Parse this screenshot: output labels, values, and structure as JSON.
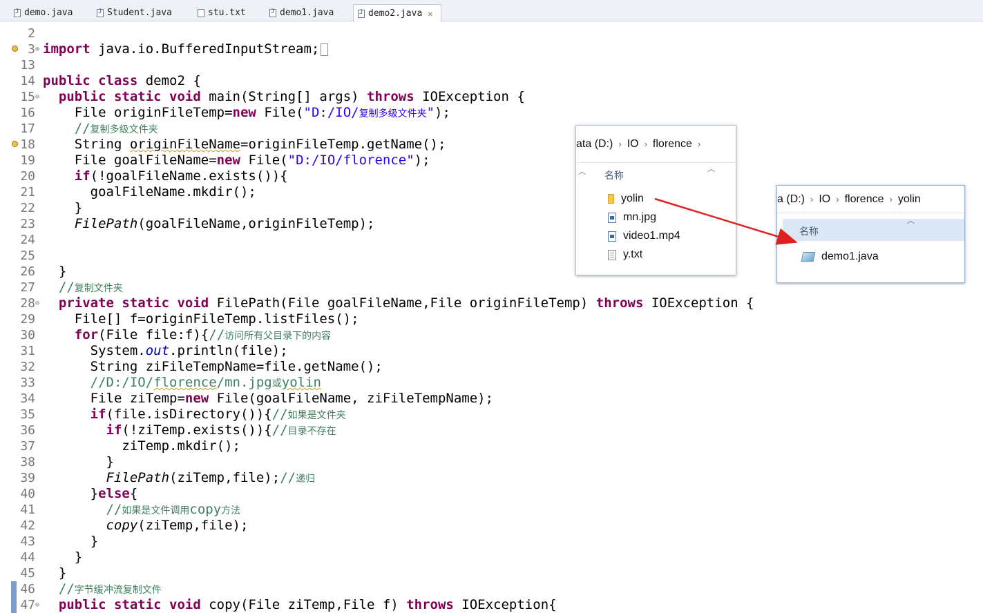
{
  "tabs": [
    {
      "label": "demo.java",
      "icon": "java-file-icon"
    },
    {
      "label": "Student.java",
      "icon": "java-file-icon"
    },
    {
      "label": "stu.txt",
      "icon": "text-file-icon"
    },
    {
      "label": "demo1.java",
      "icon": "java-file-icon"
    },
    {
      "label": "demo2.java",
      "icon": "java-file-icon",
      "active": true,
      "close": "✕"
    }
  ],
  "code_lines": [
    {
      "n": "2",
      "t": []
    },
    {
      "n": "3",
      "fold": "⊕",
      "marker": true,
      "t": [
        [
          "kw",
          "import"
        ],
        [
          "",
          "  java.io.BufferedInputStream;"
        ]
      ],
      "box": true
    },
    {
      "n": "13",
      "t": []
    },
    {
      "n": "14",
      "t": [
        [
          "kw",
          "public class"
        ],
        [
          "",
          "  demo2 {"
        ]
      ]
    },
    {
      "n": "15",
      "fold": "⊖",
      "t": [
        [
          "",
          "    "
        ],
        [
          "kw",
          "public static void"
        ],
        [
          "",
          "  main(String[] args) "
        ],
        [
          "kw",
          "throws"
        ],
        [
          "",
          "  IOException {"
        ]
      ]
    },
    {
      "n": "16",
      "t": [
        [
          "",
          "        File originFileTemp="
        ],
        [
          "kw",
          "new"
        ],
        [
          "",
          "  File("
        ],
        [
          "str",
          "\"D:/IO/"
        ],
        [
          "str cn",
          "复制多级文件夹"
        ],
        [
          "str",
          "\""
        ],
        [
          "",
          ");"
        ]
      ]
    },
    {
      "n": "17",
      "t": [
        [
          "",
          "        "
        ],
        [
          "cm",
          "//"
        ],
        [
          "cm cn",
          "复制多级文件夹"
        ]
      ]
    },
    {
      "n": "18",
      "marker": true,
      "t": [
        [
          "",
          "        String "
        ],
        [
          "sq",
          "originFileName"
        ],
        [
          "",
          "=originFileTemp.getName();"
        ]
      ]
    },
    {
      "n": "19",
      "t": [
        [
          "",
          "        File goalFileName="
        ],
        [
          "kw",
          "new"
        ],
        [
          "",
          "  File("
        ],
        [
          "str",
          "\"D:/IO/florence\""
        ],
        [
          "",
          ");"
        ]
      ]
    },
    {
      "n": "20",
      "t": [
        [
          "",
          "        "
        ],
        [
          "kw",
          "if"
        ],
        [
          "",
          "(!goalFileName.exists()){"
        ]
      ]
    },
    {
      "n": "21",
      "t": [
        [
          "",
          "            goalFileName.mkdir();"
        ]
      ]
    },
    {
      "n": "22",
      "t": [
        [
          "",
          "        }"
        ]
      ]
    },
    {
      "n": "23",
      "t": [
        [
          "",
          "        "
        ],
        [
          "it",
          "FilePath"
        ],
        [
          "",
          "(goalFileName,originFileTemp);"
        ]
      ]
    },
    {
      "n": "24",
      "t": []
    },
    {
      "n": "25",
      "t": []
    },
    {
      "n": "26",
      "t": [
        [
          "",
          "    }"
        ]
      ]
    },
    {
      "n": "27",
      "t": [
        [
          "",
          "    "
        ],
        [
          "cm",
          "//"
        ],
        [
          "cm cn",
          "复制文件夹"
        ]
      ]
    },
    {
      "n": "28",
      "fold": "⊖",
      "t": [
        [
          "",
          "    "
        ],
        [
          "kw",
          "private static void"
        ],
        [
          "",
          "  FilePath(File goalFileName,File originFileTemp) "
        ],
        [
          "kw",
          "throws"
        ],
        [
          "",
          "  IOException {"
        ]
      ]
    },
    {
      "n": "29",
      "t": [
        [
          "",
          "        File[] f=originFileTemp.listFiles();"
        ]
      ]
    },
    {
      "n": "30",
      "t": [
        [
          "",
          "        "
        ],
        [
          "kw",
          "for"
        ],
        [
          "",
          "(File file:f){"
        ],
        [
          "cm",
          "//"
        ],
        [
          "cm cn",
          "访问所有父目录下的内容"
        ]
      ]
    },
    {
      "n": "31",
      "t": [
        [
          "",
          "            System."
        ],
        [
          "fld",
          "out"
        ],
        [
          "",
          ".println(file);"
        ]
      ]
    },
    {
      "n": "32",
      "t": [
        [
          "",
          "            String ziFileTempName=file.getName();"
        ]
      ]
    },
    {
      "n": "33",
      "t": [
        [
          "",
          "            "
        ],
        [
          "cm",
          "//D:/IO/"
        ],
        [
          "cm sq",
          "florence"
        ],
        [
          "cm",
          "/mn.jpg"
        ],
        [
          "cm cn",
          "或"
        ],
        [
          "cm sq",
          "yolin"
        ]
      ]
    },
    {
      "n": "34",
      "t": [
        [
          "",
          "            File ziTemp="
        ],
        [
          "kw",
          "new"
        ],
        [
          "",
          "  File(goalFileName, ziFileTempName);"
        ]
      ]
    },
    {
      "n": "35",
      "t": [
        [
          "",
          "            "
        ],
        [
          "kw",
          "if"
        ],
        [
          "",
          "(file.isDirectory()){"
        ],
        [
          "cm",
          "//"
        ],
        [
          "cm cn",
          "如果是文件夹"
        ]
      ]
    },
    {
      "n": "36",
      "t": [
        [
          "",
          "                "
        ],
        [
          "kw",
          "if"
        ],
        [
          "",
          "(!ziTemp.exists()){"
        ],
        [
          "cm",
          "//"
        ],
        [
          "cm cn",
          "目录不存在"
        ]
      ]
    },
    {
      "n": "37",
      "t": [
        [
          "",
          "                    ziTemp.mkdir();"
        ]
      ]
    },
    {
      "n": "38",
      "t": [
        [
          "",
          "                }"
        ]
      ]
    },
    {
      "n": "39",
      "t": [
        [
          "",
          "                "
        ],
        [
          "it",
          "FilePath"
        ],
        [
          "",
          "(ziTemp,file);"
        ],
        [
          "cm",
          "//"
        ],
        [
          "cm cn",
          "递归"
        ]
      ]
    },
    {
      "n": "40",
      "t": [
        [
          "",
          "            }"
        ],
        [
          "kw",
          "else"
        ],
        [
          "",
          "{"
        ]
      ]
    },
    {
      "n": "41",
      "t": [
        [
          "",
          "                "
        ],
        [
          "cm",
          "//"
        ],
        [
          "cm cn",
          "如果是文件调用"
        ],
        [
          "cm",
          "copy"
        ],
        [
          "cm cn",
          "方法"
        ]
      ]
    },
    {
      "n": "42",
      "t": [
        [
          "",
          "                "
        ],
        [
          "it",
          "copy"
        ],
        [
          "",
          "(ziTemp,file);"
        ]
      ]
    },
    {
      "n": "43",
      "t": [
        [
          "",
          "            }"
        ]
      ]
    },
    {
      "n": "44",
      "t": [
        [
          "",
          "        }"
        ]
      ]
    },
    {
      "n": "45",
      "t": [
        [
          "",
          "    }"
        ]
      ]
    },
    {
      "n": "46",
      "bar": true,
      "t": [
        [
          "",
          "    "
        ],
        [
          "cm",
          "//"
        ],
        [
          "cm cn",
          "字节缓冲流复制文件"
        ]
      ]
    },
    {
      "n": "47",
      "fold": "⊖",
      "bar": true,
      "t": [
        [
          "",
          "    "
        ],
        [
          "kw",
          "public static void"
        ],
        [
          "",
          "  copy(File ziTemp,File f) "
        ],
        [
          "kw",
          "throws"
        ],
        [
          "",
          "  IOException{"
        ]
      ]
    }
  ],
  "explorer_left": {
    "breadcrumb": [
      "ata (D:)",
      "IO",
      "florence"
    ],
    "header": "名称",
    "items": [
      {
        "name": "yolin",
        "type": "folder"
      },
      {
        "name": "mn.jpg",
        "type": "image"
      },
      {
        "name": "video1.mp4",
        "type": "video"
      },
      {
        "name": "y.txt",
        "type": "text"
      }
    ]
  },
  "explorer_right": {
    "breadcrumb": [
      "a (D:)",
      "IO",
      "florence",
      "yolin"
    ],
    "header": "名称",
    "items": [
      {
        "name": "demo1.java",
        "type": "java"
      }
    ]
  },
  "colors": {
    "keyword": "#7f0055",
    "string": "#2a00ff",
    "comment": "#3f7f5f",
    "arrow": "#e02020"
  }
}
